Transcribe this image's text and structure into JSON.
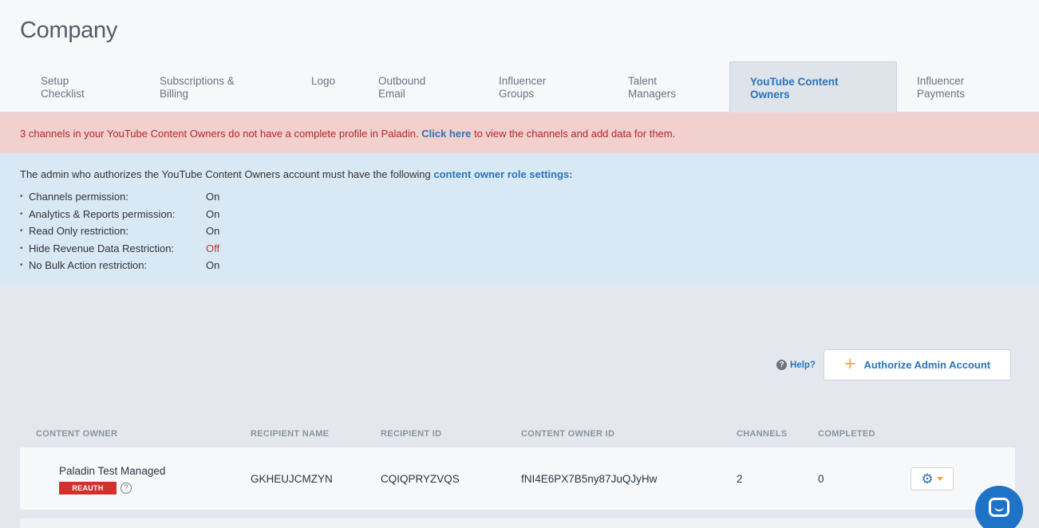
{
  "page": {
    "title": "Company"
  },
  "tabs": [
    {
      "label": "Setup Checklist"
    },
    {
      "label": "Subscriptions & Billing"
    },
    {
      "label": "Logo"
    },
    {
      "label": "Outbound Email"
    },
    {
      "label": "Influencer Groups"
    },
    {
      "label": "Talent Managers"
    },
    {
      "label": "YouTube Content Owners",
      "active": true
    },
    {
      "label": "Influencer Payments"
    }
  ],
  "alert_incomplete": {
    "prefix": "3 channels in your YouTube Content Owners do not have a complete profile in Paladin. ",
    "link": "Click here",
    "suffix": " to view the channels and add data for them."
  },
  "role_settings": {
    "lead": "The admin who authorizes the YouTube Content Owners account must have the following ",
    "link": "content owner role settings:",
    "items": [
      {
        "label": "Channels permission:",
        "value": "On"
      },
      {
        "label": "Analytics & Reports permission:",
        "value": "On"
      },
      {
        "label": "Read Only restriction:",
        "value": "On"
      },
      {
        "label": "Hide Revenue Data Restriction:",
        "value": "Off"
      },
      {
        "label": "No Bulk Action restriction:",
        "value": "On"
      }
    ]
  },
  "actions": {
    "help_label": "Help?",
    "authorize_label": "Authorize Admin Account"
  },
  "table": {
    "headers": [
      "CONTENT OWNER",
      "RECIPIENT NAME",
      "RECIPIENT ID",
      "CONTENT OWNER ID",
      "CHANNELS",
      "COMPLETED"
    ],
    "rows": [
      {
        "content_owner": "Paladin Test Managed",
        "badge": "REAUTH",
        "recipient_name": "GKHEUJCMZYN",
        "recipient_id": "CQIQPRYZVQS",
        "content_owner_id": "fNI4E6PX7B5ny87JuQJyHw",
        "channels": "2",
        "completed": "0"
      }
    ]
  },
  "colors": {
    "accent": "#2a74b9",
    "danger": "#d0312d",
    "warning_bg": "#f2d0cd",
    "info_bg": "#d9e8f5",
    "plus_orange": "#f0a92d"
  },
  "icons": {
    "help": "question-circle-icon",
    "plus": "plus-icon",
    "gear": "gear-icon",
    "caret": "caret-down-icon",
    "chat": "chat-icon"
  }
}
